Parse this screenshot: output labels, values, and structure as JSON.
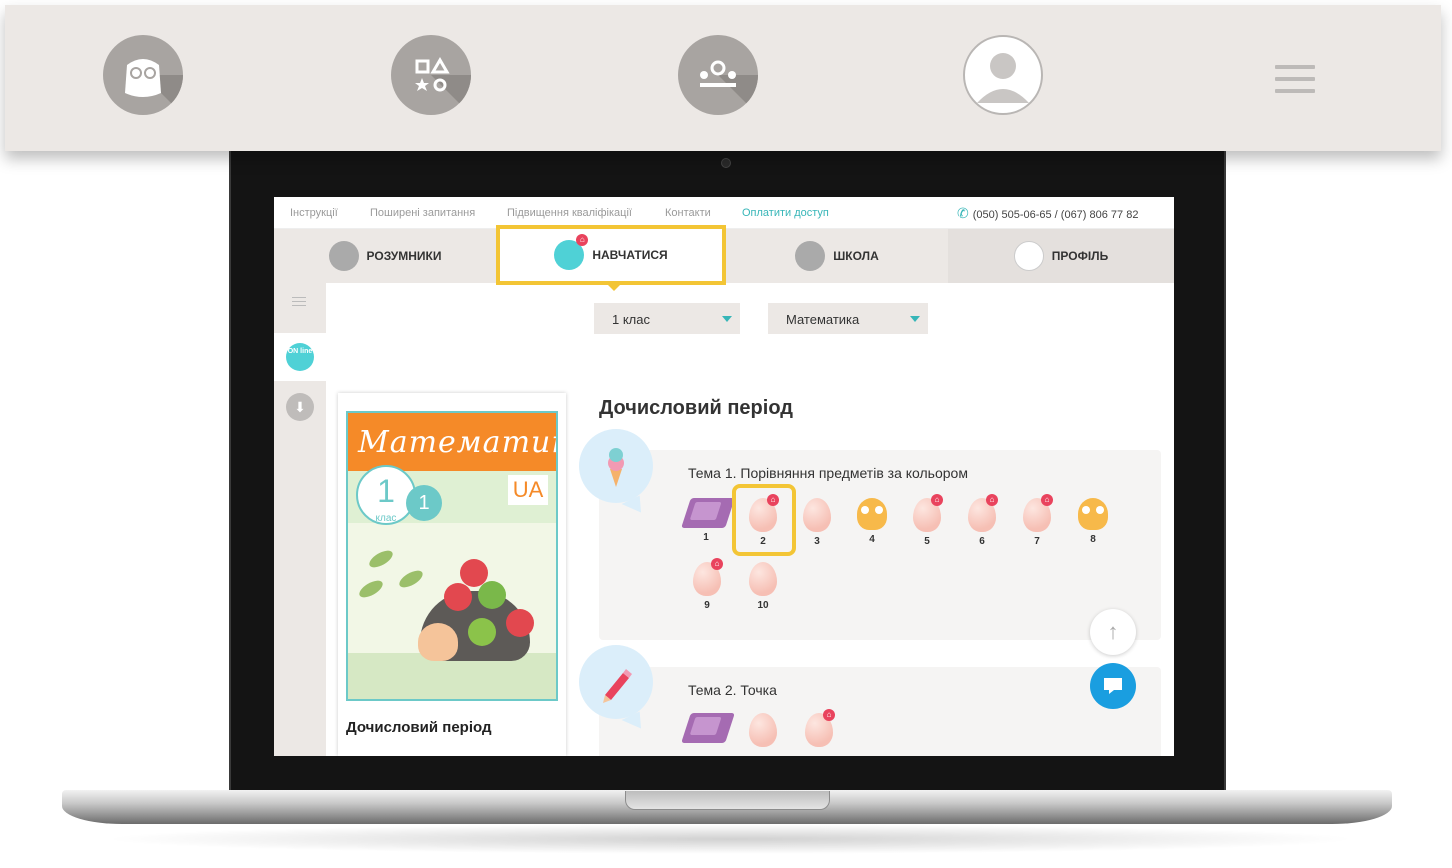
{
  "top_nav": {
    "icons": [
      "owl-icon",
      "shapes-icon",
      "school-icon",
      "profile-icon"
    ],
    "menu_icon": "hamburger-icon"
  },
  "site": {
    "info_links": [
      "Інструкції",
      "Поширені запитання",
      "Підвищення кваліфікації",
      "Контакти"
    ],
    "pay_link": "Оплатити доступ",
    "phone": "(050) 505-06-65 / (067) 806 77 82",
    "tabs": [
      {
        "label": "РОЗУМНИКИ",
        "icon": "owl-icon"
      },
      {
        "label": "НАВЧАТИСЯ",
        "icon": "shapes-icon"
      },
      {
        "label": "ШКОЛА",
        "icon": "school-icon"
      },
      {
        "label": "ПРОФІЛЬ",
        "icon": "profile-icon"
      }
    ],
    "active_tab": "НАВЧАТИСЯ",
    "sidebar": {
      "online_label": "ON line",
      "download_icon": "download-icon"
    },
    "grade_select": "1 клас",
    "subject_select": "Математика",
    "book": {
      "cover_title": "Математика",
      "cover_grade": "1",
      "cover_grade_word": "клас",
      "cover_part": "1",
      "cover_lang": "UA",
      "title": "Дочисловий період"
    },
    "section_title": "Дочисловий період",
    "topics": [
      {
        "title": "Тема 1. Порівняння предметів за кольором",
        "icon": "ice-cream-icon",
        "lessons": [
          {
            "num": "1",
            "type": "book"
          },
          {
            "num": "2",
            "type": "egg",
            "home": true,
            "highlighted": true
          },
          {
            "num": "3",
            "type": "egg"
          },
          {
            "num": "4",
            "type": "owl"
          },
          {
            "num": "5",
            "type": "egg",
            "home": true
          },
          {
            "num": "6",
            "type": "egg",
            "home": true
          },
          {
            "num": "7",
            "type": "egg",
            "home": true
          },
          {
            "num": "8",
            "type": "owl"
          },
          {
            "num": "9",
            "type": "egg",
            "home": true
          },
          {
            "num": "10",
            "type": "egg"
          }
        ]
      },
      {
        "title": "Тема 2. Точка",
        "icon": "pencil-icon",
        "lessons": [
          {
            "type": "book"
          },
          {
            "type": "egg"
          },
          {
            "type": "egg",
            "home": true
          }
        ]
      }
    ],
    "scroll_top_icon": "arrow-up-icon",
    "chat_icon": "chat-icon"
  },
  "colors": {
    "accent_yellow": "#f3c535",
    "teal": "#37b6b8",
    "badge_red": "#e9435d",
    "nav_bg": "#ece8e5",
    "chat_blue": "#1a9ee0"
  }
}
